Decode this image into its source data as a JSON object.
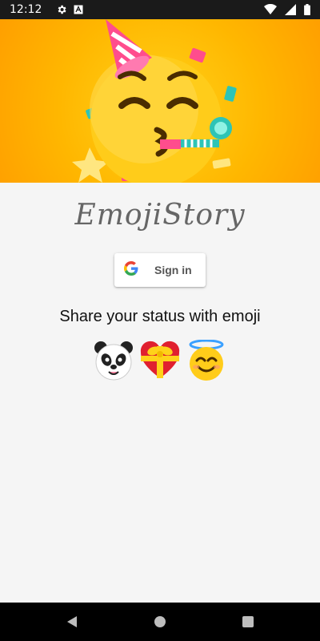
{
  "status_bar": {
    "time": "12:12",
    "icons_left": [
      "settings-icon",
      "a-square-icon"
    ],
    "icons_right": [
      "wifi-icon",
      "signal-icon",
      "battery-icon"
    ]
  },
  "hero": {
    "image": "party-face-emoji-illustration",
    "background_color": "#ffb700"
  },
  "app": {
    "title": "EmojiStory"
  },
  "signin": {
    "label": "Sign in",
    "icon": "google-g-icon"
  },
  "tagline": "Share your status with emoji",
  "emojis": [
    {
      "name": "panda-face-emoji"
    },
    {
      "name": "heart-with-ribbon-emoji"
    },
    {
      "name": "smiling-face-with-halo-emoji"
    }
  ],
  "nav_bar": {
    "buttons": [
      "back-icon",
      "home-icon",
      "recents-icon"
    ]
  },
  "colors": {
    "status_bar": "#1a1a1a",
    "background": "#f5f5f5",
    "title": "#666666",
    "nav_bar": "#000000"
  }
}
